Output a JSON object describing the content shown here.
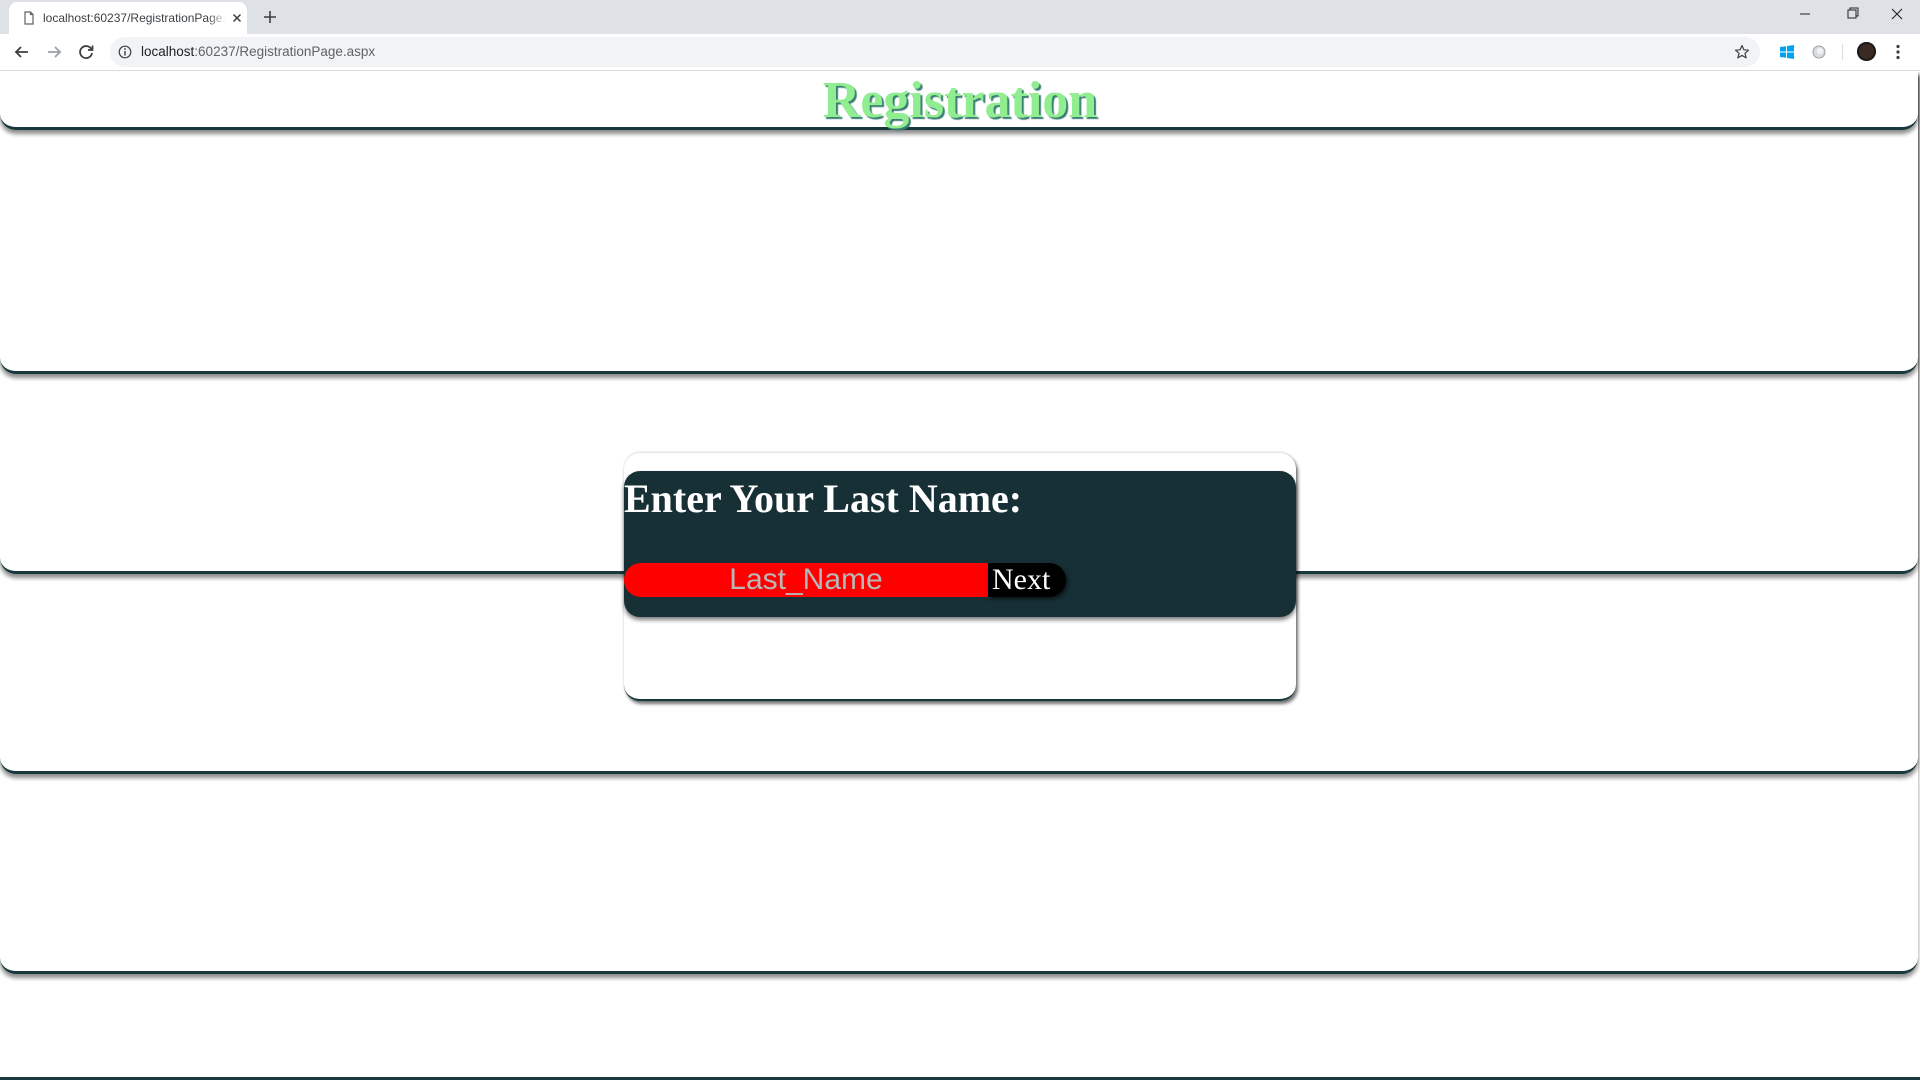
{
  "browser": {
    "tab_title": "localhost:60237/RegistrationPage.aspx",
    "url_host": "localhost",
    "url_rest": ":60237/RegistrationPage.aspx",
    "icons": {
      "favicon": "document-icon",
      "close": "close-icon",
      "new_tab": "plus-icon",
      "back": "back-arrow-icon",
      "forward": "forward-arrow-icon",
      "reload": "reload-icon",
      "site_info": "info-icon",
      "bookmark": "star-icon",
      "extension_1": "windows-icon",
      "extension_2": "circle-extension-icon",
      "profile": "avatar",
      "menu": "kebab-menu-icon",
      "minimize": "minimize-icon",
      "maximize": "restore-icon",
      "close_window": "close-window-icon"
    }
  },
  "page": {
    "title": "Registration",
    "prompt": "Enter Your Last Name:",
    "input_placeholder": "Last_Name",
    "input_value": "",
    "next_label": "Next"
  },
  "colors": {
    "title": "#90ee90",
    "title_shadow": "#3a7d73",
    "panel": "#173036",
    "band_border": "#17383d",
    "input_bg": "#ff0000",
    "button_bg": "#000000"
  }
}
